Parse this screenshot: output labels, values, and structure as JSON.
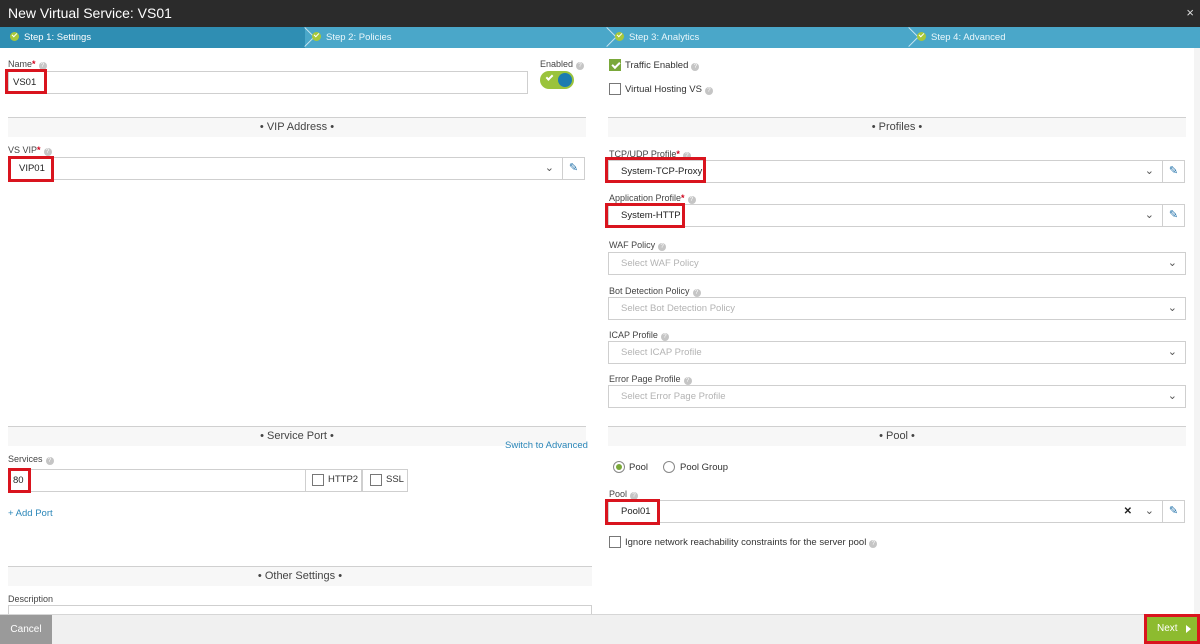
{
  "window": {
    "title": "New Virtual Service: VS01",
    "close_icon": "×"
  },
  "steps": [
    {
      "label": "Step 1: Settings",
      "state": "active"
    },
    {
      "label": "Step 2: Policies",
      "state": "done"
    },
    {
      "label": "Step 3: Analytics",
      "state": "done"
    },
    {
      "label": "Step 4: Advanced",
      "state": "done"
    }
  ],
  "left": {
    "name": {
      "label": "Name",
      "value": "VS01"
    },
    "enabled": {
      "label": "Enabled",
      "on": true
    },
    "vip_section": "• VIP Address •",
    "vs_vip": {
      "label": "VS VIP",
      "value": "VIP01"
    },
    "service_port_section": "• Service Port •",
    "switch_advanced": "Switch to Advanced",
    "services": {
      "label": "Services",
      "value": "80",
      "http2": "HTTP2",
      "ssl": "SSL"
    },
    "add_port": "+ Add Port",
    "other_section": "• Other Settings •",
    "description": {
      "label": "Description"
    }
  },
  "right": {
    "traffic_enabled": {
      "label": "Traffic Enabled",
      "checked": true
    },
    "virtual_hosting": {
      "label": "Virtual Hosting VS",
      "checked": false
    },
    "profiles_section": "• Profiles •",
    "tcp_udp_profile": {
      "label": "TCP/UDP Profile",
      "value": "System-TCP-Proxy"
    },
    "application_profile": {
      "label": "Application Profile",
      "value": "System-HTTP"
    },
    "waf_policy": {
      "label": "WAF Policy",
      "placeholder": "Select WAF Policy"
    },
    "bot_policy": {
      "label": "Bot Detection Policy",
      "placeholder": "Select Bot Detection Policy"
    },
    "icap_profile": {
      "label": "ICAP Profile",
      "placeholder": "Select ICAP Profile"
    },
    "error_page_profile": {
      "label": "Error Page Profile",
      "placeholder": "Select Error Page Profile"
    },
    "pool_section": "• Pool •",
    "pool_radio": "Pool",
    "pool_group_radio": "Pool Group",
    "pool": {
      "label": "Pool",
      "value": "Pool01"
    },
    "ignore_reachability": "Ignore network reachability constraints for the server pool"
  },
  "footer": {
    "cancel": "Cancel",
    "next": "Next"
  },
  "colors": {
    "steps_bar": "#4aa7c9",
    "active_step": "#2f8eb3",
    "next_button": "#8dbb2f",
    "highlight": "#d9141e"
  }
}
